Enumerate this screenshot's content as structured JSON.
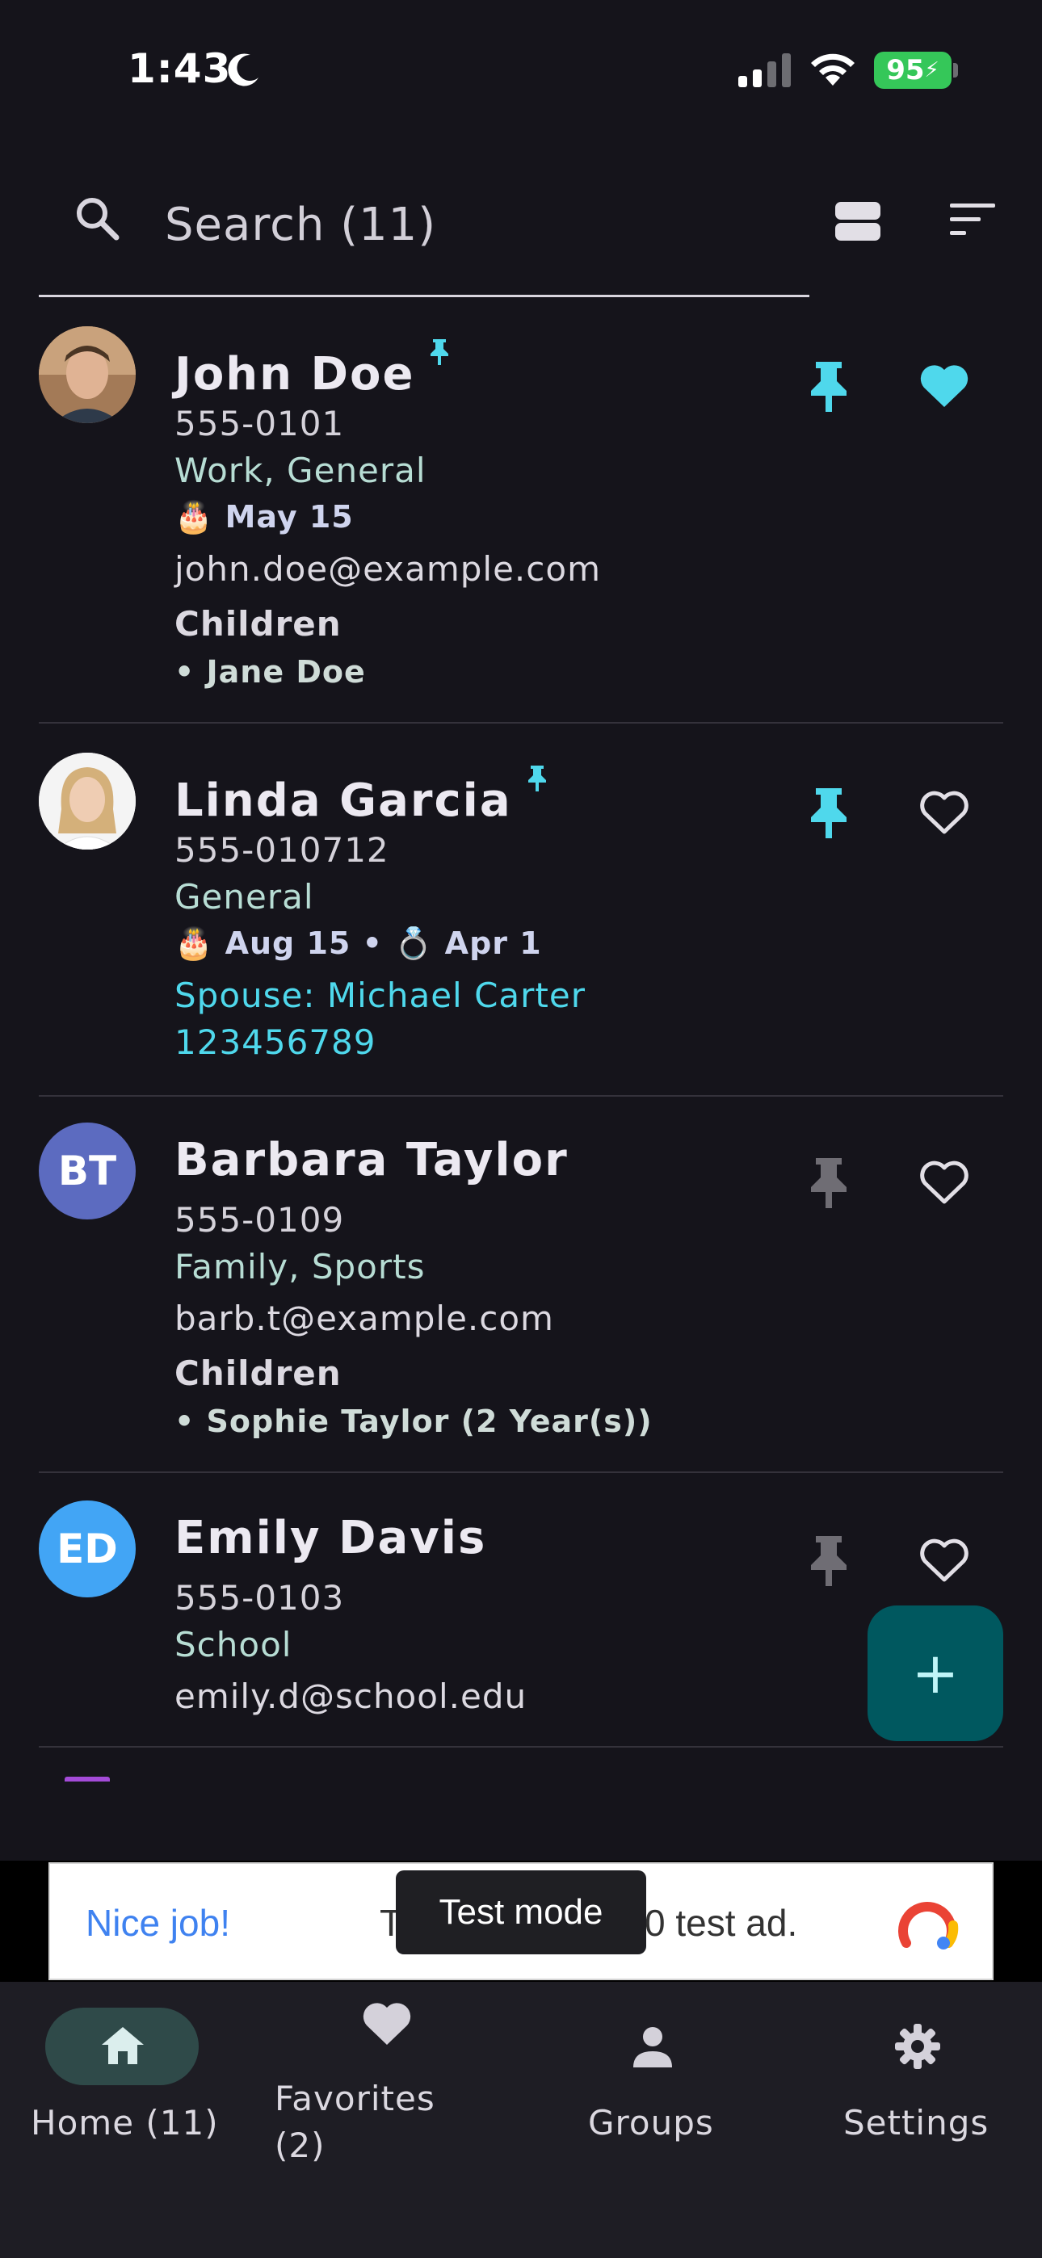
{
  "status_bar": {
    "time": "1:43",
    "battery": "95"
  },
  "search": {
    "placeholder": "Search (11)"
  },
  "contacts": [
    {
      "name": "John Doe",
      "avatar_type": "photo",
      "phone": "555-0101",
      "groups": "Work, General",
      "dates": "May 15",
      "email": "john.doe@example.com",
      "children_heading": "Children",
      "children": [
        "• Jane Doe"
      ],
      "pinned": true,
      "favorite": true
    },
    {
      "name": "Linda Garcia",
      "avatar_type": "photo",
      "phone": "555-010712",
      "groups": "General",
      "birthday": "Aug 15",
      "separator": "•",
      "anniversary": "Apr 1",
      "spouse": "Spouse: Michael Carter",
      "spouse_phone": "123456789",
      "pinned": true,
      "favorite": false
    },
    {
      "name": "Barbara Taylor",
      "initials": "BT",
      "avatar_color": "#5c6bc0",
      "phone": "555-0109",
      "groups": "Family, Sports",
      "email": "barb.t@example.com",
      "children_heading": "Children",
      "children": [
        "• Sophie Taylor (2 Year(s))"
      ],
      "pinned": false,
      "favorite": false
    },
    {
      "name": "Emily Davis",
      "initials": "ED",
      "avatar_color": "#42a5f5",
      "phone": "555-0103",
      "groups": "School",
      "email": "emily.d@school.edu",
      "pinned": false,
      "favorite": false
    }
  ],
  "fab": {
    "label": "+"
  },
  "ad": {
    "left_text": "Nice job!",
    "mid_text": "T",
    "right_text": "0 test ad.",
    "toast": "Test mode"
  },
  "nav": {
    "home": "Home (11)",
    "favorites_line1": "Favorites",
    "favorites_line2": "(2)",
    "groups": "Groups",
    "settings": "Settings"
  },
  "colors": {
    "background": "#15141b",
    "accent": "#4fd8ec",
    "pin_inactive": "#6f6d74",
    "fab": "#00585f"
  }
}
